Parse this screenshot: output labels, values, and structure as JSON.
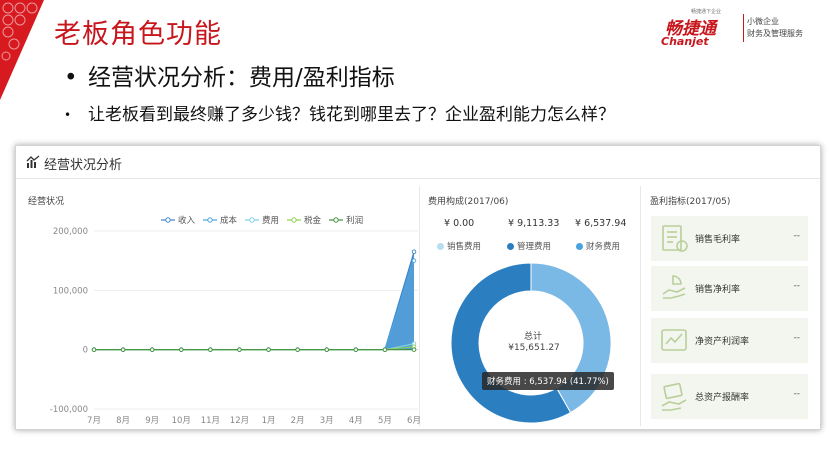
{
  "slide": {
    "title": "老板角色功能",
    "bullet1": "经营状况分析：费用/盈利指标",
    "bullet2": "让老板看到最终赚了多少钱？钱花到哪里去了？企业盈利能力怎么样？",
    "bullet_glyph": "•"
  },
  "logo": {
    "mini": "畅捷通下企业",
    "brand": "畅捷通",
    "sub": "Chanjet",
    "tag1": "小微企业",
    "tag2": "财务及管理服务"
  },
  "panel": {
    "title": "经营状况分析",
    "sections": {
      "business": "经营状况",
      "fees": "费用构成(2017/06)",
      "profit": "盈利指标(2017/05)"
    }
  },
  "colors": {
    "brand_red": "#c8161d",
    "revenue": "#3e86c6",
    "cost": "#4aa3df",
    "expense": "#7fd0e6",
    "tax": "#8fd14f",
    "profit": "#3f8f3f",
    "admin_fee": "#2b7fc1",
    "finance_fee": "#7ab8e6",
    "sales_fee": "#b8dcf2"
  },
  "chart_data": [
    {
      "type": "line",
      "title": "经营状况",
      "categories": [
        "7月",
        "8月",
        "9月",
        "10月",
        "11月",
        "12月",
        "1月",
        "2月",
        "3月",
        "4月",
        "5月",
        "6月"
      ],
      "yticks": [
        "200,000",
        "100,000",
        "0",
        "-100,000"
      ],
      "ylim": [
        -100000,
        200000
      ],
      "series": [
        {
          "name": "收入",
          "values": [
            0,
            0,
            0,
            0,
            0,
            0,
            0,
            0,
            0,
            0,
            0,
            165000
          ]
        },
        {
          "name": "成本",
          "values": [
            0,
            0,
            0,
            0,
            0,
            0,
            0,
            0,
            0,
            0,
            0,
            150000
          ]
        },
        {
          "name": "费用",
          "values": [
            0,
            0,
            0,
            0,
            0,
            0,
            0,
            0,
            0,
            0,
            0,
            10000
          ]
        },
        {
          "name": "税金",
          "values": [
            0,
            0,
            0,
            0,
            0,
            0,
            0,
            0,
            0,
            0,
            0,
            5000
          ]
        },
        {
          "name": "利润",
          "values": [
            0,
            0,
            0,
            0,
            0,
            0,
            0,
            0,
            0,
            0,
            0,
            0
          ]
        }
      ]
    },
    {
      "type": "pie",
      "title": "费用构成(2017/06)",
      "series": [
        {
          "name": "销售费用",
          "amount": "¥ 0.00",
          "value": 0
        },
        {
          "name": "管理费用",
          "amount": "¥ 9,113.33",
          "value": 9113.33
        },
        {
          "name": "财务费用",
          "amount": "¥ 6,537.94",
          "value": 6537.94
        }
      ],
      "total_label": "总计",
      "total_value": "¥15,651.27",
      "tooltip": "财务费用 : 6,537.94 (41.77%)"
    }
  ],
  "profit_cards": [
    {
      "label": "销售毛利率",
      "value": "--",
      "icon": "bill-icon"
    },
    {
      "label": "销售净利率",
      "value": "--",
      "icon": "pie-hand-icon"
    },
    {
      "label": "净资产利润率",
      "value": "--",
      "icon": "chart-icon"
    },
    {
      "label": "总资产报酬率",
      "value": "--",
      "icon": "money-hand-icon"
    }
  ]
}
